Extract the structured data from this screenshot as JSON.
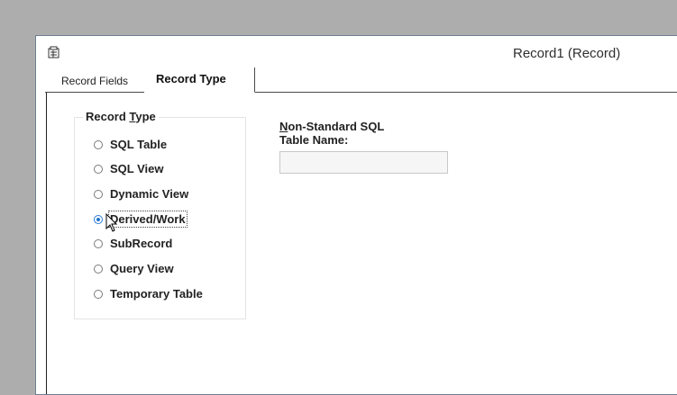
{
  "window": {
    "title": "Record1 (Record)",
    "icon": "document-icon"
  },
  "tabs": [
    {
      "label": "Record Fields",
      "active": false
    },
    {
      "label": "Record Type",
      "active": true
    }
  ],
  "record_type": {
    "group_label_prefix": "Record ",
    "group_label_mnemonic": "T",
    "group_label_suffix": "ype",
    "options": [
      {
        "label": "SQL Table",
        "selected": false
      },
      {
        "label": "SQL View",
        "selected": false
      },
      {
        "label": "Dynamic View",
        "selected": false
      },
      {
        "label": "Derived/Work",
        "selected": true
      },
      {
        "label": "SubRecord",
        "selected": false
      },
      {
        "label": "Query View",
        "selected": false
      },
      {
        "label": "Temporary Table",
        "selected": false
      }
    ]
  },
  "sql_table": {
    "label_mnemonic": "N",
    "label_rest": "on-Standard SQL",
    "label_line2": "Table Name:",
    "value": "",
    "placeholder": ""
  }
}
